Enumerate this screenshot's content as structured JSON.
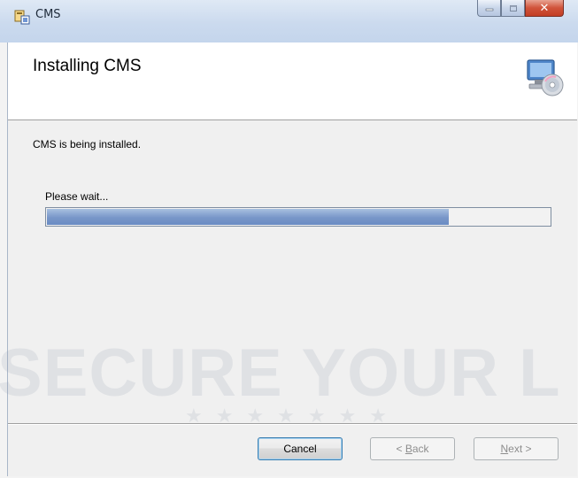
{
  "window": {
    "title": "CMS",
    "controls": {
      "minimize_icon": "minimize-icon",
      "maximize_icon": "maximize-icon",
      "close_icon": "close-icon"
    }
  },
  "banner": {
    "title": "Installing CMS",
    "icon": "install-disc-icon"
  },
  "body": {
    "status": "CMS is being installed.",
    "wait_label": "Please wait...",
    "progress_fraction": 0.8
  },
  "watermark": {
    "text": "SECURE YOUR L"
  },
  "buttons": {
    "cancel": "Cancel",
    "back_prefix": "< ",
    "back_accel": "B",
    "back_rest": "ack",
    "next_accel": "N",
    "next_rest": "ext >"
  },
  "colors": {
    "titlebar": "#cbdaee",
    "close_button": "#c94a30",
    "progress_fill": "#7896c8"
  }
}
